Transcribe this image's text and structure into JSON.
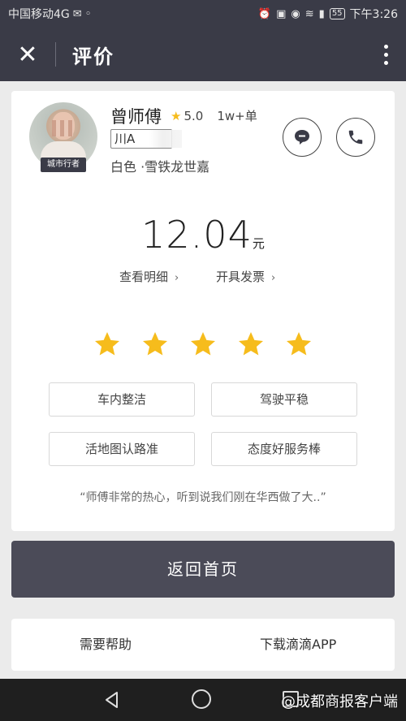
{
  "status_bar": {
    "carrier": "中国移动4G",
    "battery": "55",
    "time": "下午3:26"
  },
  "app_bar": {
    "title": "评价",
    "close_icon": "close-icon",
    "more_icon": "more-vertical-icon"
  },
  "driver": {
    "name": "曾师傅",
    "rating": "5.0",
    "orders": "1w+单",
    "plate": "川A",
    "car": "白色 ·雪铁龙世嘉",
    "badge": "城市行者"
  },
  "fare": {
    "amount": "12.04",
    "unit": "元",
    "detail_link": "查看明细",
    "invoice_link": "开具发票"
  },
  "rating_stars": {
    "value": 5,
    "max": 5,
    "color": "#f6bc1c"
  },
  "tags": [
    "车内整洁",
    "驾驶平稳",
    "活地图认路准",
    "态度好服务棒"
  ],
  "comment": "“师傅非常的热心，听到说我们刚在华西做了大..”",
  "home_button": "返回首页",
  "footer": {
    "help": "需要帮助",
    "download": "下载滴滴APP"
  },
  "watermark": "@成都商报客户端",
  "colors": {
    "header_bg": "#3a3b47",
    "primary_button": "#4b4b58",
    "star": "#f6bc1c"
  }
}
